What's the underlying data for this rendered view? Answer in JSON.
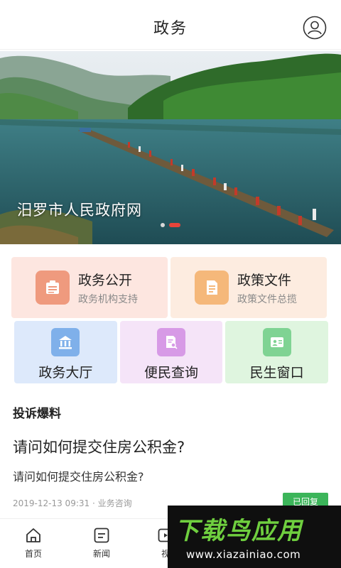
{
  "header": {
    "title": "政务"
  },
  "banner": {
    "caption": "汨罗市人民政府网",
    "slide_count": 2,
    "active_slide": 2
  },
  "features_top": [
    {
      "title": "政务公开",
      "subtitle": "政务机构支持",
      "icon": "document-list-icon",
      "bg": "#fde6e0",
      "icon_bg": "#ef9a7e"
    },
    {
      "title": "政策文件",
      "subtitle": "政策文件总揽",
      "icon": "file-icon",
      "bg": "#fdece0",
      "icon_bg": "#f5b87a"
    }
  ],
  "features_bottom": [
    {
      "label": "政务大厅",
      "icon": "bank-icon",
      "bg": "#dde9fb",
      "icon_bg": "#7fb0ea"
    },
    {
      "label": "便民查询",
      "icon": "search-document-icon",
      "bg": "#f5e4f8",
      "icon_bg": "#d79ae6"
    },
    {
      "label": "民生窗口",
      "icon": "id-card-icon",
      "bg": "#dff5df",
      "icon_bg": "#7fd393"
    }
  ],
  "complaint": {
    "section_title": "投诉爆料",
    "question_title": "请问如何提交住房公积金?",
    "question_sub": "请问如何提交住房公积金?",
    "meta": "2019-12-13 09:31 · 业务咨询",
    "status": "已回复"
  },
  "tabbar": {
    "items": [
      {
        "label": "首页",
        "icon": "home-icon"
      },
      {
        "label": "新闻",
        "icon": "news-icon"
      },
      {
        "label": "视",
        "icon": "video-icon"
      }
    ]
  },
  "watermark": {
    "brand": "下载鸟应用",
    "url": "www.xiazainiao.com"
  },
  "colors": {
    "accent": "#e8443a",
    "badge": "#3cb55a"
  }
}
